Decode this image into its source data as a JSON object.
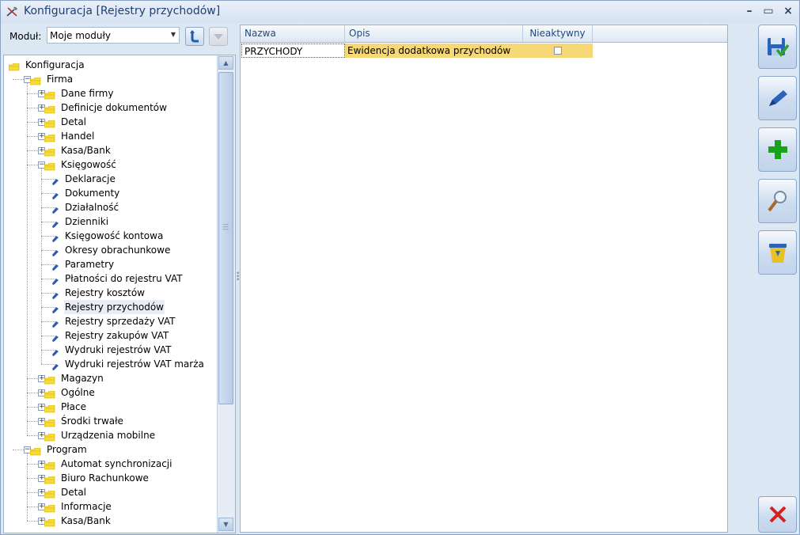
{
  "window": {
    "title": "Konfiguracja [Rejestry przychodów]",
    "minimize": "–",
    "maximize": "▭",
    "close": "×"
  },
  "module": {
    "label": "Moduł:",
    "value": "Moje moduły"
  },
  "tree": [
    {
      "label": "Konfiguracja",
      "level": 0,
      "type": "root"
    },
    {
      "label": "Firma",
      "level": 1,
      "type": "folder",
      "expanded": true
    },
    {
      "label": "Dane firmy",
      "level": 2,
      "type": "folder"
    },
    {
      "label": "Definicje dokumentów",
      "level": 2,
      "type": "folder"
    },
    {
      "label": "Detal",
      "level": 2,
      "type": "folder"
    },
    {
      "label": "Handel",
      "level": 2,
      "type": "folder"
    },
    {
      "label": "Kasa/Bank",
      "level": 2,
      "type": "folder"
    },
    {
      "label": "Księgowość",
      "level": 2,
      "type": "folder",
      "expanded": true
    },
    {
      "label": "Deklaracje",
      "level": 3,
      "type": "leaf"
    },
    {
      "label": "Dokumenty",
      "level": 3,
      "type": "leaf"
    },
    {
      "label": "Działalność",
      "level": 3,
      "type": "leaf"
    },
    {
      "label": "Dzienniki",
      "level": 3,
      "type": "leaf"
    },
    {
      "label": "Księgowość kontowa",
      "level": 3,
      "type": "leaf"
    },
    {
      "label": "Okresy obrachunkowe",
      "level": 3,
      "type": "leaf"
    },
    {
      "label": "Parametry",
      "level": 3,
      "type": "leaf"
    },
    {
      "label": "Płatności do rejestru VAT",
      "level": 3,
      "type": "leaf"
    },
    {
      "label": "Rejestry kosztów",
      "level": 3,
      "type": "leaf"
    },
    {
      "label": "Rejestry przychodów",
      "level": 3,
      "type": "leaf",
      "selected": true
    },
    {
      "label": "Rejestry sprzedaży VAT",
      "level": 3,
      "type": "leaf"
    },
    {
      "label": "Rejestry zakupów VAT",
      "level": 3,
      "type": "leaf"
    },
    {
      "label": "Wydruki rejestrów VAT",
      "level": 3,
      "type": "leaf"
    },
    {
      "label": "Wydruki rejestrów VAT marża",
      "level": 3,
      "type": "leaf"
    },
    {
      "label": "Magazyn",
      "level": 2,
      "type": "folder"
    },
    {
      "label": "Ogólne",
      "level": 2,
      "type": "folder"
    },
    {
      "label": "Płace",
      "level": 2,
      "type": "folder"
    },
    {
      "label": "Środki trwałe",
      "level": 2,
      "type": "folder"
    },
    {
      "label": "Urządzenia mobilne",
      "level": 2,
      "type": "folder"
    },
    {
      "label": "Program",
      "level": 1,
      "type": "folder",
      "expanded": true
    },
    {
      "label": "Automat synchronizacji",
      "level": 2,
      "type": "folder"
    },
    {
      "label": "Biuro Rachunkowe",
      "level": 2,
      "type": "folder"
    },
    {
      "label": "Detal",
      "level": 2,
      "type": "folder"
    },
    {
      "label": "Informacje",
      "level": 2,
      "type": "folder"
    },
    {
      "label": "Kasa/Bank",
      "level": 2,
      "type": "folder"
    }
  ],
  "grid": {
    "columns": [
      "Nazwa",
      "Opis",
      "Nieaktywny"
    ],
    "rows": [
      {
        "nazwa": "PRZYCHODY",
        "opis": "Ewidencja dodatkowa przychodów",
        "nieaktywny": false
      }
    ]
  },
  "actions": [
    {
      "name": "save",
      "icon": "save-icon"
    },
    {
      "name": "edit",
      "icon": "edit-icon"
    },
    {
      "name": "add",
      "icon": "add-icon"
    },
    {
      "name": "preview",
      "icon": "magnifier-icon"
    },
    {
      "name": "delete",
      "icon": "trash-icon"
    },
    {
      "name": "close",
      "icon": "close-x-icon"
    }
  ],
  "colors": {
    "accent": "#1f3f73",
    "row_highlight": "#f7d876",
    "folder": "#f5dc3a",
    "add": "#1aa31a",
    "close": "#d42020"
  }
}
